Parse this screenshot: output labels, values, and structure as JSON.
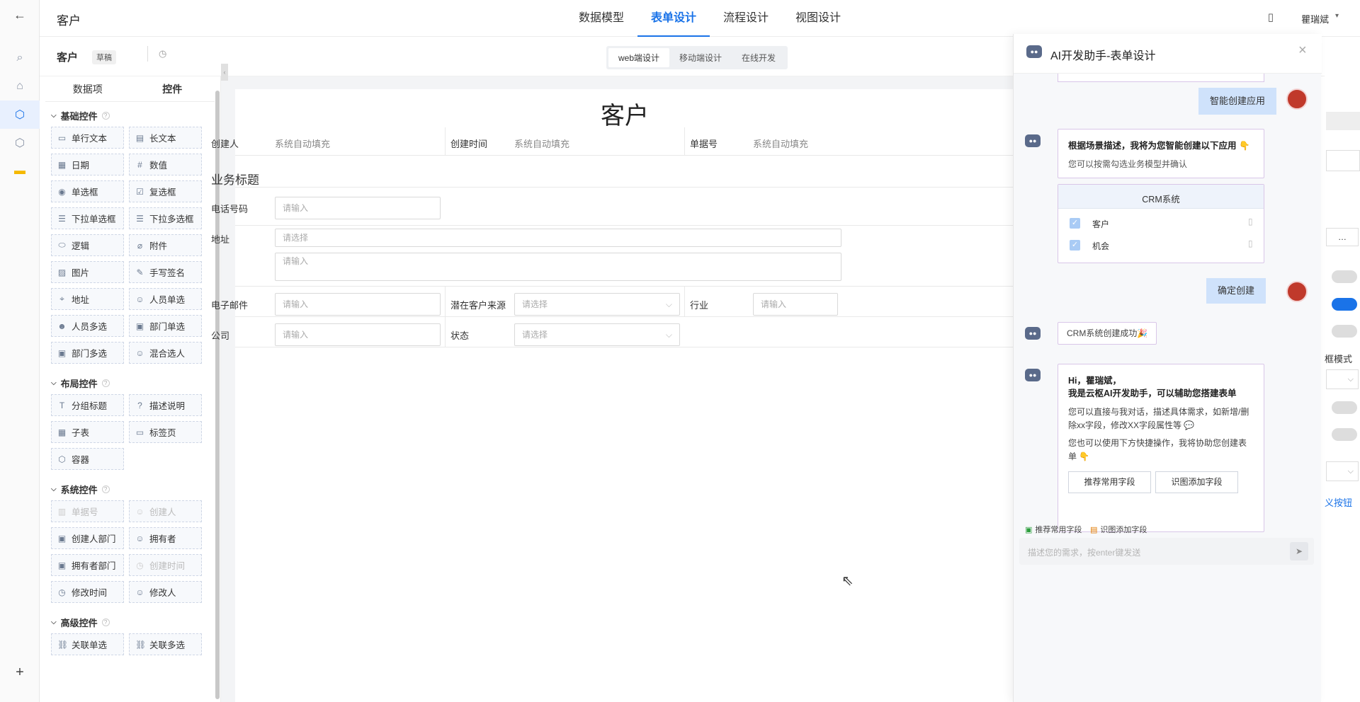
{
  "top": {
    "title": "客户",
    "tabs": [
      "数据模型",
      "表单设计",
      "流程设计",
      "视图设计"
    ],
    "active_tab": 1,
    "user": "瞿瑞斌"
  },
  "sub": {
    "form_name": "客户",
    "status": "草稿",
    "modes": [
      "web端设计",
      "移动端设计",
      "在线开发"
    ],
    "active_mode": 0
  },
  "left": {
    "tabs": [
      "数据项",
      "控件"
    ],
    "groups": [
      {
        "title": "基础控件",
        "items": [
          {
            "label": "单行文本",
            "icon": "text-icon"
          },
          {
            "label": "长文本",
            "icon": "textarea-icon"
          },
          {
            "label": "日期",
            "icon": "calendar-icon"
          },
          {
            "label": "数值",
            "icon": "number-icon"
          },
          {
            "label": "单选框",
            "icon": "radio-icon"
          },
          {
            "label": "复选框",
            "icon": "checkbox-icon"
          },
          {
            "label": "下拉单选框",
            "icon": "list-icon"
          },
          {
            "label": "下拉多选框",
            "icon": "list-icon"
          },
          {
            "label": "逻辑",
            "icon": "toggle-icon"
          },
          {
            "label": "附件",
            "icon": "paperclip-icon"
          },
          {
            "label": "图片",
            "icon": "image-icon"
          },
          {
            "label": "手写签名",
            "icon": "pen-icon"
          },
          {
            "label": "地址",
            "icon": "location-icon"
          },
          {
            "label": "人员单选",
            "icon": "user-icon"
          },
          {
            "label": "人员多选",
            "icon": "users-icon"
          },
          {
            "label": "部门单选",
            "icon": "dept-icon"
          },
          {
            "label": "部门多选",
            "icon": "dept-icon"
          },
          {
            "label": "混合选人",
            "icon": "user-icon"
          }
        ]
      },
      {
        "title": "布局控件",
        "items": [
          {
            "label": "分组标题",
            "icon": "title-icon"
          },
          {
            "label": "描述说明",
            "icon": "help-icon"
          },
          {
            "label": "子表",
            "icon": "table-icon"
          },
          {
            "label": "标签页",
            "icon": "tabs-icon"
          },
          {
            "label": "容器",
            "icon": "box-icon"
          }
        ]
      },
      {
        "title": "系统控件",
        "items": [
          {
            "label": "单据号",
            "icon": "barcode-icon",
            "disabled": true
          },
          {
            "label": "创建人",
            "icon": "user-icon",
            "disabled": true
          },
          {
            "label": "创建人部门",
            "icon": "dept-icon"
          },
          {
            "label": "拥有者",
            "icon": "user-icon"
          },
          {
            "label": "拥有者部门",
            "icon": "dept-icon"
          },
          {
            "label": "创建时间",
            "icon": "clock-icon",
            "disabled": true
          },
          {
            "label": "修改时间",
            "icon": "clock-icon"
          },
          {
            "label": "修改人",
            "icon": "user-icon"
          }
        ]
      },
      {
        "title": "高级控件",
        "items": [
          {
            "label": "关联单选",
            "icon": "link-icon"
          },
          {
            "label": "关联多选",
            "icon": "link-icon"
          }
        ]
      }
    ]
  },
  "form": {
    "title": "客户",
    "sys_fields": [
      {
        "label": "创建人",
        "value": "系统自动填充"
      },
      {
        "label": "创建时间",
        "value": "系统自动填充"
      },
      {
        "label": "单据号",
        "value": "系统自动填充"
      }
    ],
    "section": "业务标题",
    "phone": {
      "label": "电话号码",
      "placeholder": "请输入"
    },
    "address": {
      "label": "地址",
      "select_placeholder": "请选择",
      "detail_placeholder": "请输入"
    },
    "email": {
      "label": "电子邮件",
      "placeholder": "请输入"
    },
    "source": {
      "label": "潜在客户来源",
      "placeholder": "请选择"
    },
    "industry": {
      "label": "行业",
      "placeholder": "请输入"
    },
    "company": {
      "label": "公司",
      "placeholder": "请输入"
    },
    "status": {
      "label": "状态",
      "placeholder": "请选择"
    }
  },
  "right_edge": {
    "mode_label": "框模式",
    "button_label": "义按钮"
  },
  "chat": {
    "title": "AI开发助手-表单设计",
    "msg1": "智能创建应用",
    "reply1_title": "根据场景描述，我将为您智能创建以下应用 👇",
    "reply1_sub": "您可以按需勾选业务模型并确认",
    "system_name": "CRM系统",
    "models": [
      "客户",
      "机会"
    ],
    "msg2": "确定创建",
    "success": "CRM系统创建成功🎉",
    "hi_line1": "Hi，瞿瑞斌，",
    "hi_line2": "我是云枢AI开发助手，可以辅助您搭建表单",
    "hi_p1": "您可以直接与我对话，描述具体需求，如新增/删除xx字段，修改XX字段属性等 💬",
    "hi_p2": "您也可以使用下方快捷操作，我将协助您创建表单 👇",
    "quick": [
      "推荐常用字段",
      "识图添加字段"
    ],
    "input_placeholder": "描述您的需求，按enter键发送"
  }
}
